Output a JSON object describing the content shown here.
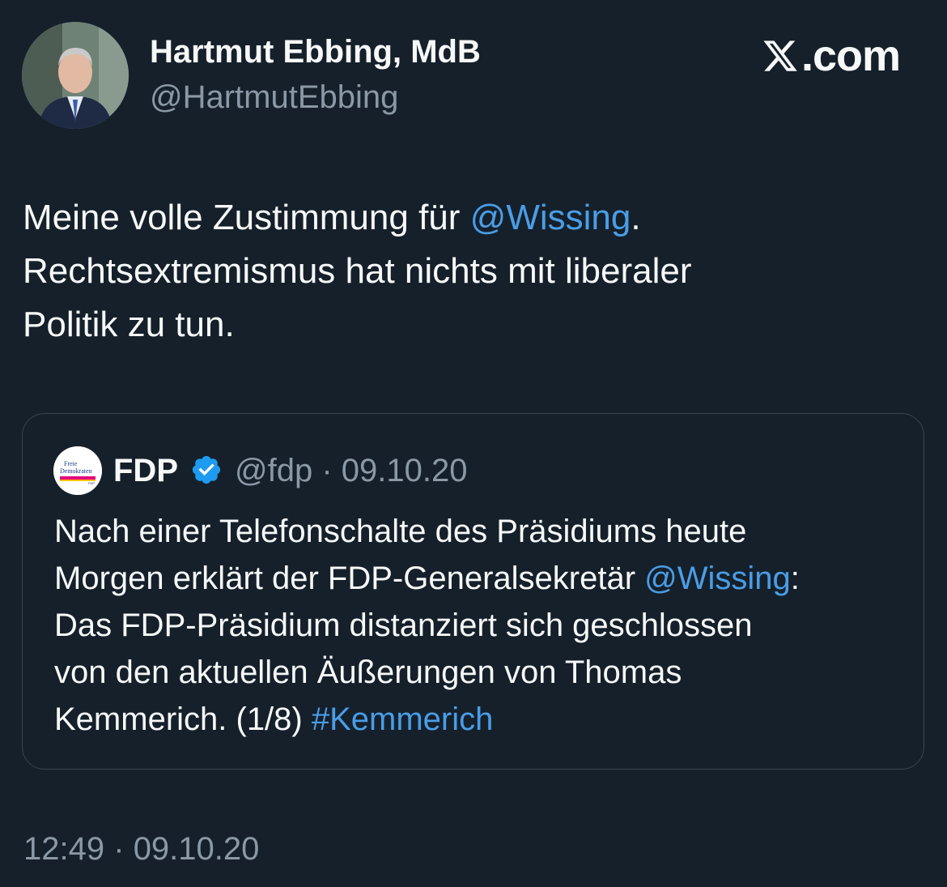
{
  "author": {
    "display_name": "Hartmut Ebbing, MdB",
    "handle": "@HartmutEbbing"
  },
  "brand": {
    "label": ".com",
    "icon": "x-logo-icon"
  },
  "tweet": {
    "part1": "Meine volle Zustimmung für ",
    "mention": "@Wissing",
    "part2": ".",
    "line2": "Rechtsextremismus hat nichts mit liberaler",
    "line3": "Politik zu tun."
  },
  "quote": {
    "name": "FDP",
    "verified": true,
    "handle": "@fdp",
    "separator": "·",
    "date": "09.10.20",
    "logo_text_1": "Freie",
    "logo_text_2": "Demokraten",
    "logo_text_3": "FDP",
    "text_line1": "Nach einer Telefonschalte des Präsidiums heute",
    "text_line2a": "Morgen erklärt der FDP-Generalsekretär ",
    "mention": "@Wissing",
    "text_line2b": ":",
    "text_line3": "Das FDP-Präsidium distanziert sich geschlossen",
    "text_line4": "von den aktuellen Äußerungen von Thomas",
    "text_line5": "Kemmerich. (1/8) ",
    "hashtag": "#Kemmerich"
  },
  "timestamp": {
    "time": "12:49",
    "separator": "·",
    "date": "09.10.20"
  },
  "colors": {
    "background": "#15202b",
    "text": "#f7f9f9",
    "secondary": "#8b98a5",
    "link": "#4a9de6",
    "verified": "#1d9bf0",
    "border": "#38444d"
  }
}
